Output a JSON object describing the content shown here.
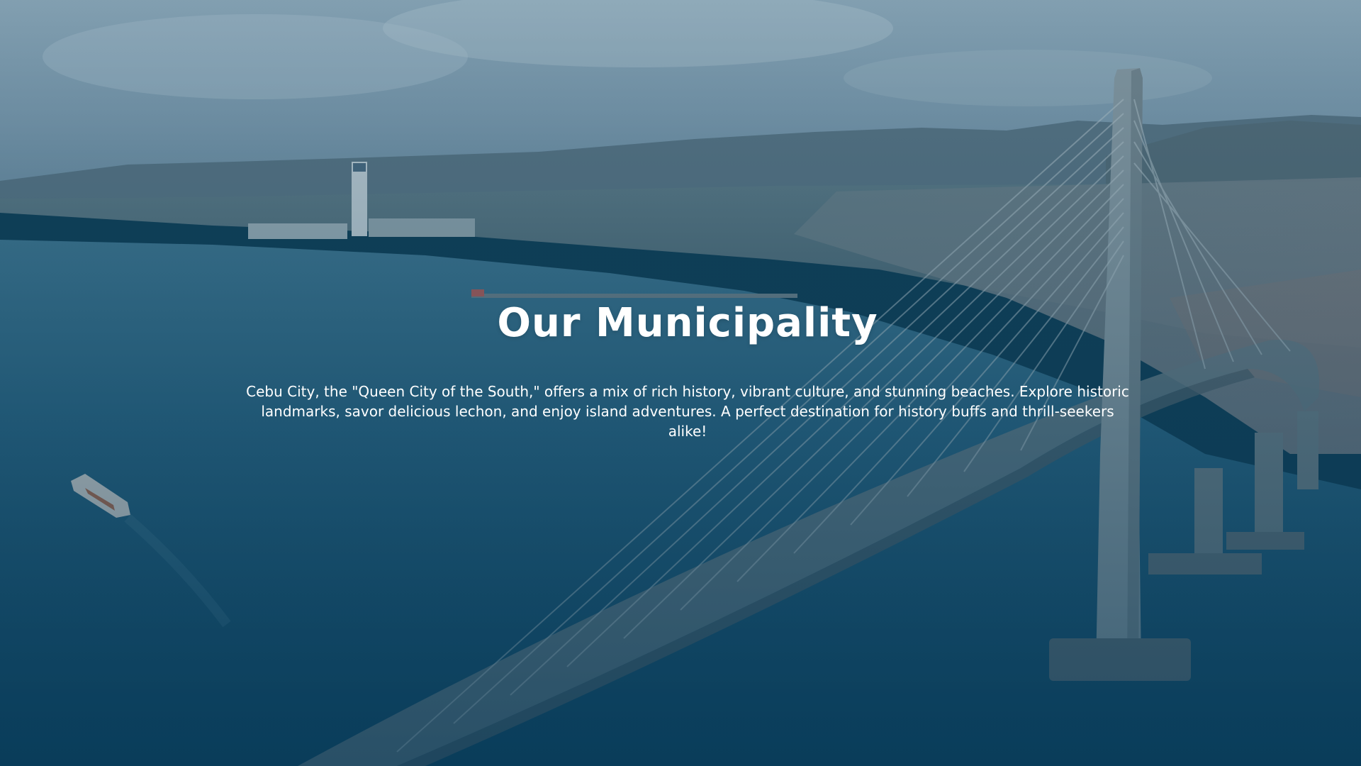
{
  "hero": {
    "title": "Our Municipality",
    "description": "Cebu City, the \"Queen City of the South,\" offers a mix of rich history, vibrant culture, and stunning beaches. Explore historic landmarks, savor delicious lechon, and enjoy island adventures. A perfect destination for history buffs and thrill-seekers alike!",
    "background_image": "aerial-photo-of-cable-stayed-bridge-over-bay-with-city-skyline"
  },
  "colors": {
    "text": "#ffffff",
    "water": "#0e4a65",
    "sky": "#7f9fb1",
    "overlay": "#0e3d55"
  }
}
